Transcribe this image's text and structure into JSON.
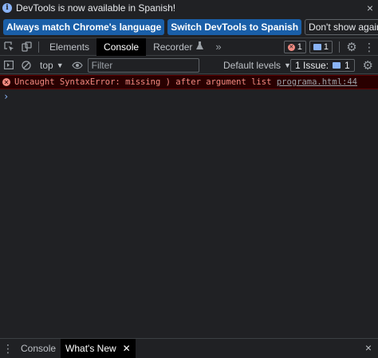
{
  "infobar": {
    "message": "DevTools is now available in Spanish!",
    "buttons": [
      "Always match Chrome's language",
      "Switch DevTools to Spanish",
      "Don't show again"
    ],
    "close": "×"
  },
  "tabs": {
    "items": [
      "Elements",
      "Console",
      "Recorder"
    ],
    "active": "Console",
    "more": "»",
    "error_count": "1",
    "message_count": "1"
  },
  "console_toolbar": {
    "context": "top",
    "filter_placeholder": "Filter",
    "levels": "Default levels",
    "issues": "1 Issue:",
    "issues_count": "1"
  },
  "console": {
    "error_message": "Uncaught SyntaxError: missing ) after argument list",
    "error_source": "programa.html:44",
    "prompt": "›"
  },
  "drawer": {
    "tabs": [
      "Console",
      "What's New"
    ],
    "active": "What's New",
    "close": "×"
  }
}
